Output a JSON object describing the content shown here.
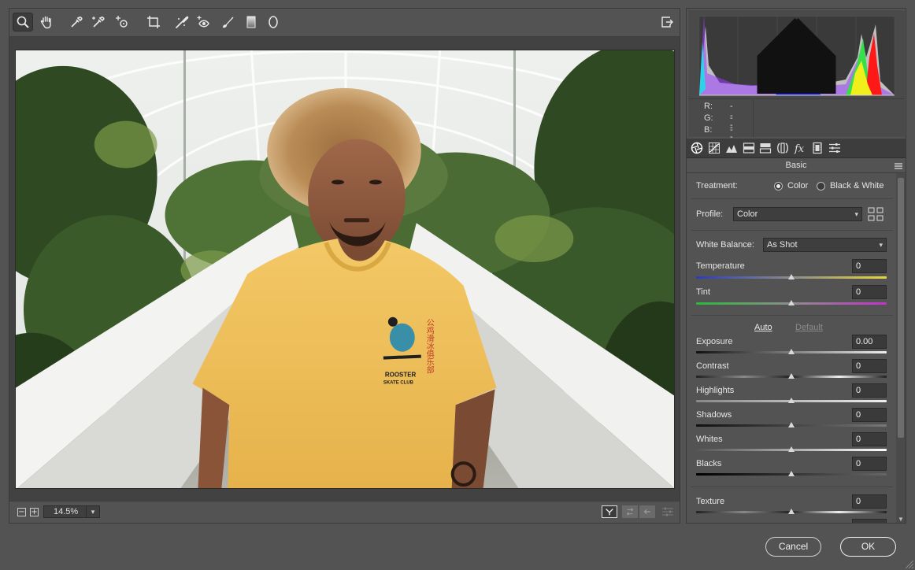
{
  "toolbar": {
    "tools": [
      {
        "name": "zoom-icon",
        "active": true
      },
      {
        "name": "hand-icon"
      },
      {
        "name": "white-balance-eyedropper-icon"
      },
      {
        "name": "color-sampler-icon"
      },
      {
        "name": "targeted-adjustment-icon"
      },
      {
        "name": "crop-icon"
      },
      {
        "name": "spot-removal-icon"
      },
      {
        "name": "red-eye-icon"
      },
      {
        "name": "adjustment-brush-icon"
      },
      {
        "name": "graduated-filter-icon"
      },
      {
        "name": "radial-filter-icon"
      }
    ],
    "right_icon": "open-preferences-icon"
  },
  "status": {
    "zoom_value": "14.5%",
    "zoom_out_label": "−",
    "zoom_in_label": "+"
  },
  "readout": {
    "r_label": "R:",
    "r_value": "---",
    "g_label": "G:",
    "g_value": "---",
    "b_label": "B:",
    "b_value": "---"
  },
  "panel": {
    "title": "Basic",
    "treatment_label": "Treatment:",
    "treatment_options": [
      "Color",
      "Black & White"
    ],
    "treatment_selected": "Color",
    "profile_label": "Profile:",
    "profile_value": "Color",
    "wb_label": "White Balance:",
    "wb_value": "As Shot",
    "auto_label": "Auto",
    "default_label": "Default",
    "sliders": [
      {
        "id": "temperature",
        "label": "Temperature",
        "value": "0",
        "position": 0.5
      },
      {
        "id": "tint",
        "label": "Tint",
        "value": "0",
        "position": 0.5
      },
      {
        "id": "exposure",
        "label": "Exposure",
        "value": "0.00",
        "position": 0.5
      },
      {
        "id": "contrast",
        "label": "Contrast",
        "value": "0",
        "position": 0.5
      },
      {
        "id": "highlights",
        "label": "Highlights",
        "value": "0",
        "position": 0.5
      },
      {
        "id": "shadows",
        "label": "Shadows",
        "value": "0",
        "position": 0.5
      },
      {
        "id": "whites",
        "label": "Whites",
        "value": "0",
        "position": 0.5
      },
      {
        "id": "blacks",
        "label": "Blacks",
        "value": "0",
        "position": 0.5
      },
      {
        "id": "texture",
        "label": "Texture",
        "value": "0",
        "position": 0.5
      }
    ]
  },
  "buttons": {
    "cancel": "Cancel",
    "ok": "OK"
  },
  "photo": {
    "shirt_text_line1": "ROOSTER",
    "shirt_text_line2": "SKATE CLUB",
    "shirt_text_cjk": "公鸡滑冰俱乐部"
  },
  "colors": {
    "accent": "#ffffff",
    "shirt": "#f1c25e"
  }
}
